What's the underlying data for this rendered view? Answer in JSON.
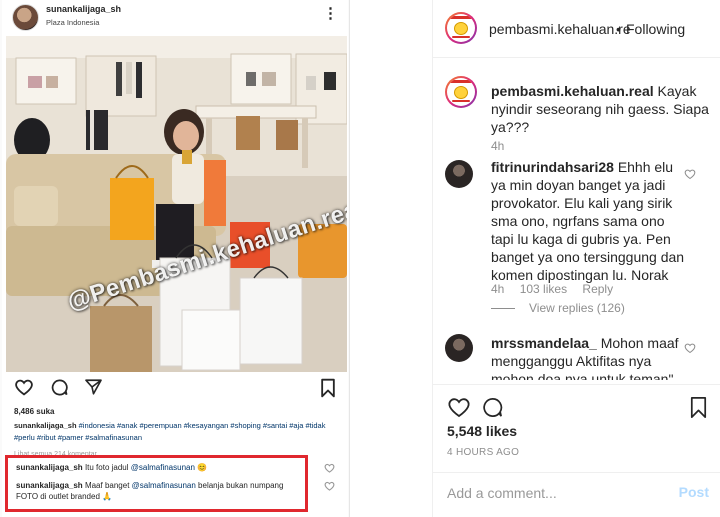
{
  "repost": {
    "username": "sunankalijaga_sh",
    "location": "Plaza Indonesia",
    "watermark": "@Pembasmi.kehaluan.real",
    "likes": "8,486 suka",
    "caption_user": "sunankalijaga_sh",
    "caption_tags": "#indonesia #anak #perempuan #kesayangan #shoping #santai #aja #tidak #perlu #ribut #pamer #salmafinasunan",
    "view_comments": "Lihat semua 214 komentar",
    "comments": [
      {
        "user": "sunankalijaga_sh",
        "text": "Itu foto jadul",
        "mention": "@salmafinasunan",
        "emoji": "😊"
      },
      {
        "user": "sunankalijaga_sh",
        "text_before": "Maaf banget",
        "mention": "@salmafinasunan",
        "text_after": "belanja bukan numpang FOTO di outlet branded 🙏"
      }
    ]
  },
  "panel": {
    "account": "pembasmi.kehaluan.re",
    "separator": "•",
    "follow_status": "Following",
    "caption": {
      "user": "pembasmi.kehaluan.real",
      "text": "Kayak nyindir seseorang nih gaess. Siapa ya???",
      "time": "4h"
    },
    "comments": [
      {
        "user": "fitrinurindahsari28",
        "text": "Ehhh elu ya min doyan banget ya jadi provokator. Elu kali yang sirik sma ono, ngrfans sama ono tapi lu kaga di gubris ya. Pen banget ya ono tersinggung dan komen dipostingan lu. Norak",
        "time": "4h",
        "likes": "103 likes",
        "reply": "Reply",
        "view_replies": "View replies (126)"
      },
      {
        "user": "mrssmandelaa_",
        "text": "Mohon maaf mengganggu Aktifitas nya mohon doa nya untuk teman\""
      }
    ],
    "likes": "5,548 likes",
    "time_ago": "4 HOURS AGO",
    "add_comment_placeholder": "Add a comment...",
    "post_label": "Post"
  },
  "colors": {
    "highlight": "#e0282e",
    "link": "#003569",
    "post_button": "#b3dbff"
  }
}
